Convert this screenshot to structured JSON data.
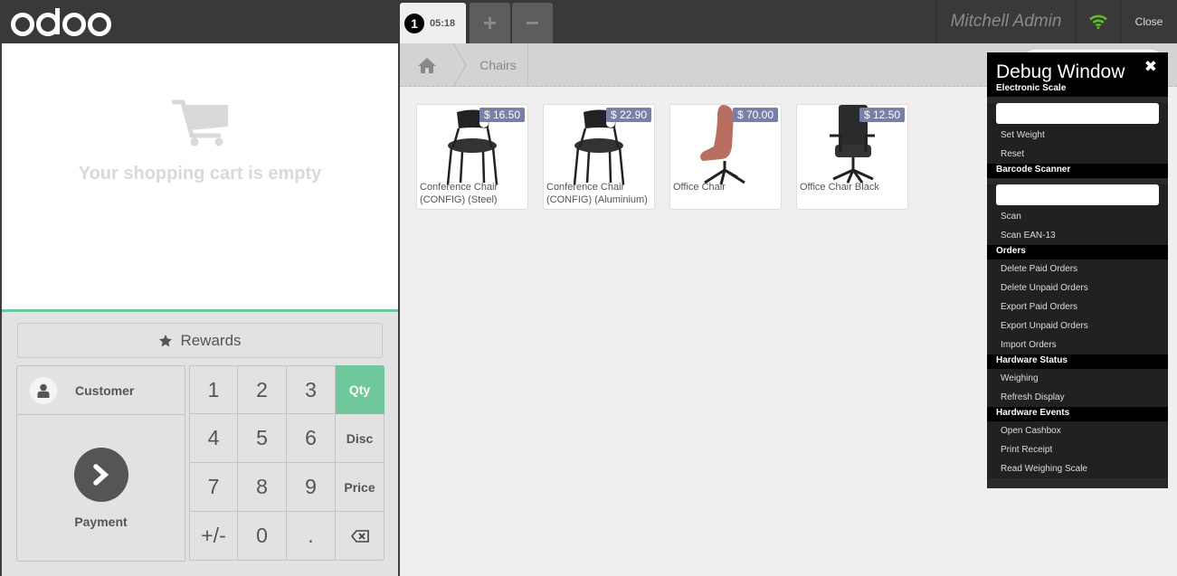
{
  "header": {
    "logo": "odoo",
    "order_tab": {
      "number": "1",
      "time": "05:18"
    },
    "add_order_icon": "plus-icon",
    "remove_order_icon": "minus-icon",
    "user_name": "Mitchell Admin",
    "connection_icon": "wifi-icon",
    "connection_color": "#5bbd2a",
    "close_label": "Close"
  },
  "cart": {
    "icon": "shopping-cart-icon",
    "empty_message": "Your shopping cart is empty"
  },
  "controls": {
    "rewards_label": "Rewards",
    "customer_label": "Customer",
    "payment_label": "Payment",
    "keys": [
      "1",
      "2",
      "3",
      "Qty",
      "4",
      "5",
      "6",
      "Disc",
      "7",
      "8",
      "9",
      "Price",
      "+/-",
      "0",
      ".",
      "backspace"
    ],
    "active_mode": "Qty",
    "accent_color": "#6ec89b"
  },
  "breadcrumbs": {
    "home_icon": "home-icon",
    "category": "Chairs"
  },
  "products": [
    {
      "name": "Conference Chair (CONFIG) (Steel)",
      "price": "$ 16.50"
    },
    {
      "name": "Conference Chair (CONFIG) (Aluminium)",
      "price": "$ 22.90"
    },
    {
      "name": "Office Chair",
      "price": "$ 70.00"
    },
    {
      "name": "Office Chair Black",
      "price": "$ 12.50"
    }
  ],
  "debug": {
    "title": "Debug Window",
    "sections": {
      "scale": {
        "title": "Electronic Scale",
        "items": [
          "Set Weight",
          "Reset"
        ]
      },
      "barcode": {
        "title": "Barcode Scanner",
        "items": [
          "Scan",
          "Scan EAN-13"
        ]
      },
      "orders": {
        "title": "Orders",
        "items": [
          "Delete Paid Orders",
          "Delete Unpaid Orders",
          "Export Paid Orders",
          "Export Unpaid Orders",
          "Import Orders"
        ]
      },
      "status": {
        "title": "Hardware Status",
        "items": [
          "Weighing",
          "Refresh Display"
        ]
      },
      "events": {
        "title": "Hardware Events",
        "items": [
          "Open Cashbox",
          "Print Receipt",
          "Read Weighing Scale"
        ]
      }
    }
  }
}
